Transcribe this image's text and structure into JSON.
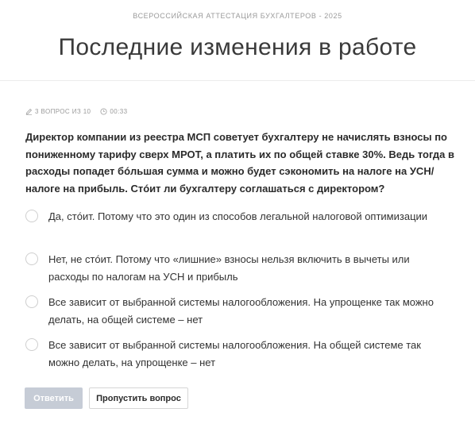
{
  "header": {
    "subtitle": "ВСЕРОССИЙСКАЯ АТТЕСТАЦИЯ БУХГАЛТЕРОВ - 2025",
    "title": "Последние изменения в работе"
  },
  "meta": {
    "question_counter": "3 ВОПРОС ИЗ 10",
    "timer": "00:33",
    "counter_icon": "pencil-icon",
    "timer_icon": "clock-icon"
  },
  "question": {
    "text": "Директор компании из реестра МСП советует бухгалтеру не начислять взносы по пониженному тарифу сверх МРОТ, а платить их по общей ставке 30%. Ведь тогда в расходы попадет бóльшая сумма и можно будет сэкономить на налоге на УСН/налоге на прибыль. Стóит ли бухгалтеру соглашаться с директором?"
  },
  "options": [
    {
      "label": "Да, стóит. Потому что это один из способов легальной налоговой оптимизации",
      "selected": false
    },
    {
      "label": "Нет, не стóит. Потому что «лишние» взносы нельзя включить в вычеты или расходы по налогам на УСН и прибыль",
      "selected": false
    },
    {
      "label": "Все зависит от выбранной системы налогообложения. На упрощенке так можно делать, на общей системе – нет",
      "selected": false
    },
    {
      "label": "Все зависит от выбранной системы налогообложения. На общей системе так можно делать, на упрощенке – нет",
      "selected": false
    }
  ],
  "actions": {
    "submit_label": "Ответить",
    "submit_disabled": true,
    "skip_label": "Пропустить вопрос"
  },
  "colors": {
    "submit_disabled_bg": "#c6ccd6",
    "muted_text": "#9a9a9a",
    "radio_border": "#cfcfcf"
  }
}
